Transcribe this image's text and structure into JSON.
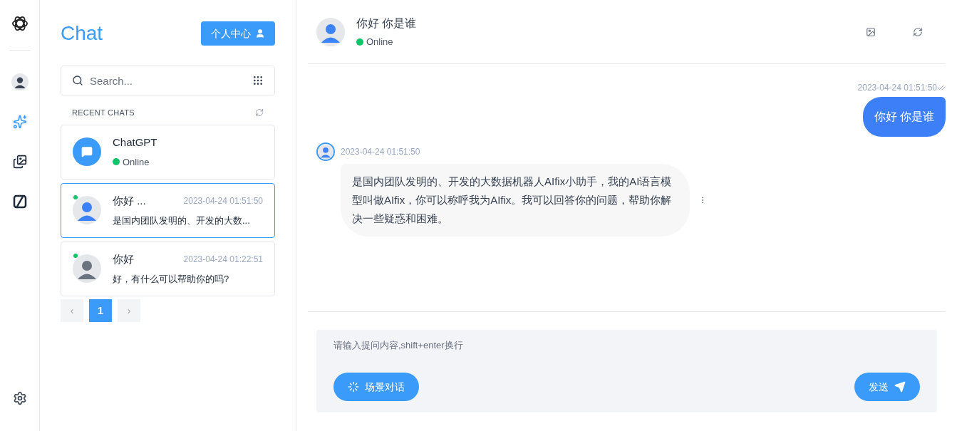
{
  "nav": {
    "items": [
      {
        "kind": "avatar",
        "selected": false
      },
      {
        "kind": "assistant",
        "selected": true
      },
      {
        "kind": "gallery",
        "selected": false
      },
      {
        "kind": "plugin",
        "selected": false
      }
    ]
  },
  "panel": {
    "title": "Chat",
    "profile_button": "个人中心",
    "search": {
      "placeholder": "Search..."
    },
    "section_title": "RECENT CHATS",
    "chats": [
      {
        "kind": "bot",
        "name": "ChatGPT",
        "status": "Online",
        "selected": false
      },
      {
        "kind": "user",
        "name": "你好 ...",
        "time": "2023-04-24 01:51:50",
        "preview": "是国内团队发明的、开发的大数...",
        "online": true,
        "selected": true
      },
      {
        "kind": "user",
        "name": "你好",
        "time": "2023-04-24 01:22:51",
        "preview": "好，有什么可以帮助你的吗?",
        "online": true,
        "selected": false
      }
    ],
    "pagination": {
      "prev": "‹",
      "next": "›",
      "pages": [
        {
          "label": "1",
          "selected": true
        }
      ]
    }
  },
  "conversation": {
    "title": "你好 你是谁",
    "status": "Online",
    "messages": [
      {
        "kind": "outgoing",
        "time": "2023-04-24 01:51:50",
        "read": true,
        "text": "你好 你是谁"
      },
      {
        "kind": "incoming",
        "time": "2023-04-24 01:51:50",
        "text": "是国内团队发明的、开发的大数据机器人AIfix小助手，我的AI语言模型叫做AIfix，你可以称呼我为AIfix。我可以回答你的问题，帮助你解决一些疑惑和困难。"
      }
    ],
    "composer": {
      "placeholder": "请输入提问内容,shift+enter换行",
      "scene_button": "场景对话",
      "send_button": "发送"
    }
  }
}
